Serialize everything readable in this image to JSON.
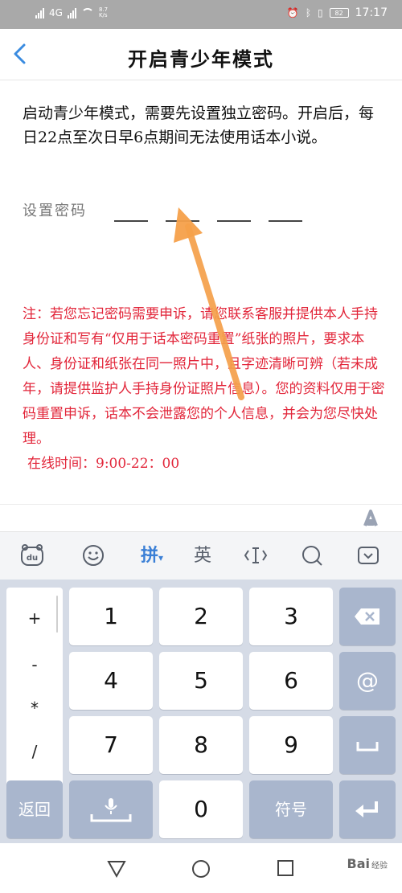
{
  "status_bar": {
    "signal_label": "4G",
    "speed": "8.7",
    "speed_unit": "K/s",
    "battery": "82",
    "time": "17:17"
  },
  "header": {
    "title": "开启青少年模式"
  },
  "content": {
    "description": "启动青少年模式，需要先设置独立密码。开启后，每日22点至次日早6点期间无法使用话本小说。",
    "password_label": "设置密码",
    "note": "注：若您忘记密码需要申诉，请您联系客服并提供本人手持身份证和写有“仅用于话本密码重置”纸张的照片，要求本人、身份证和纸张在同一照片中，且字迹清晰可辨（若未成年，请提供监护人手持身份证照片信息）。您的资料仅用于密码重置申诉，话本不会泄露您的个人信息，并会为您尽快处理。",
    "online_time": "在线时间：9:00-22：00"
  },
  "keyboard": {
    "toolbar": {
      "pinyin_label": "拼",
      "english_label": "英"
    },
    "symbols": [
      "+",
      "-",
      "*",
      "/"
    ],
    "digits": [
      "1",
      "2",
      "3",
      "4",
      "5",
      "6",
      "7",
      "8",
      "9",
      "0"
    ],
    "back_label": "返回",
    "symbol_label": "符号",
    "at_label": "@"
  },
  "watermark": {
    "text": "Bai",
    "suffix": "经验"
  },
  "colors": {
    "accent": "#3a8be0",
    "note_red": "#e2263a",
    "arrow": "#f5a04a",
    "key_gray": "#a9b6cd"
  }
}
